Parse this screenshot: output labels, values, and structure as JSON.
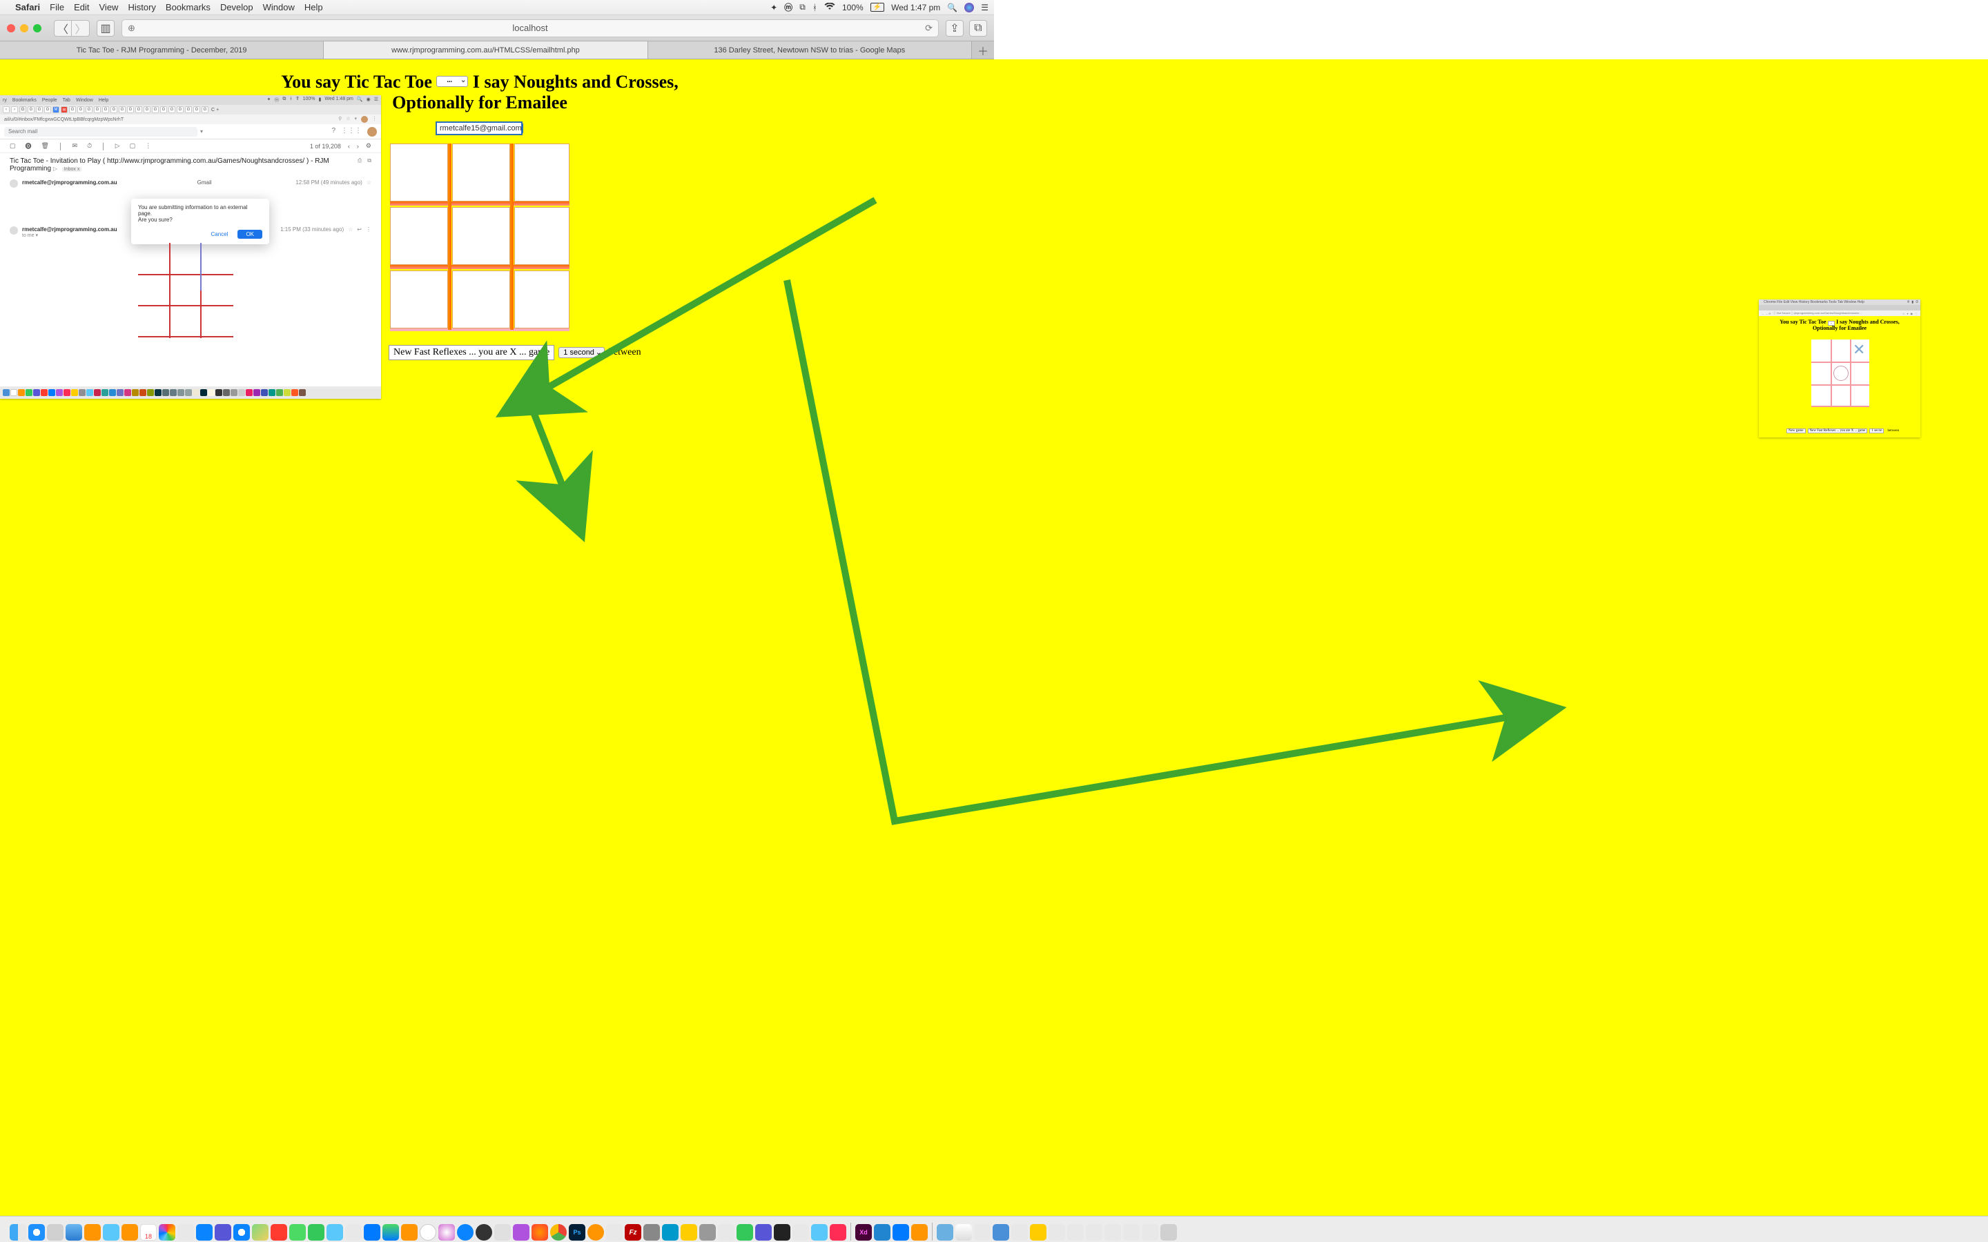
{
  "menubar": {
    "app": "Safari",
    "items": [
      "File",
      "Edit",
      "View",
      "History",
      "Bookmarks",
      "Develop",
      "Window",
      "Help"
    ],
    "battery": "100%",
    "clock": "Wed 1:47 pm"
  },
  "safari": {
    "url": "localhost",
    "tabs": [
      "Tic Tac Toe - RJM Programming - December, 2019",
      "www.rjmprogramming.com.au/HTMLCSS/emailhtml.php",
      "136 Darley Street, Newtown NSW to trias - Google Maps"
    ],
    "active_tab_index": 1
  },
  "page": {
    "headline_a": "You say Tic Tac Toe",
    "headline_select": "...",
    "headline_b": "I say Noughts and Crosses,",
    "headline_c": "Optionally for Emailee",
    "email_value": "rmetcalfe15@gmail.com",
    "status_text": "New Fast Reflexes ... you are X ... game",
    "status_select": "1 second",
    "status_after": "between"
  },
  "gmail": {
    "menubar_items": [
      "ry",
      "Bookmarks",
      "People",
      "Tab",
      "Window",
      "Help"
    ],
    "menubar_clock": "Wed 1:48 pm",
    "menubar_battery": "100%",
    "url": "ail/u/0/#inbox/FMfcgxwGCQWtLtpBBfcqrgMzpWpsNrhT",
    "search_placeholder": "Search mail",
    "count": "1 of 19,208",
    "subject": "Tic Tac Toe - Invitation to Play ( http://www.rjmprogramming.com.au/Games/Noughtsandcrosses/ ) - RJM Programming",
    "inbox_badge": "Inbox x",
    "from1": "rmetcalfe@rjmprogramming.com.au",
    "from1_label": "Gmail",
    "from1_time": "12:58 PM (49 minutes ago)",
    "dialog_line1": "You are submitting information to an external page.",
    "dialog_line2": "Are you sure?",
    "dialog_cancel": "Cancel",
    "dialog_ok": "OK",
    "from2": "rmetcalfe@rjmprogramming.com.au",
    "from2_to": "to me",
    "from2_time": "1:15 PM (33 minutes ago)"
  },
  "chrome_mini": {
    "menubar": "Chrome  File  Edit  View  History  Bookmarks  Tools  Tab  Window  Help",
    "url_prefix": "Not Secure",
    "url": "rjmprogramming.com.au/Games/Noughtsandcrosses/...",
    "headline_a": "You say Tic Tac Toe",
    "headline_b": "I say Noughts and Crosses,",
    "headline_c": "Optionally for Emailee",
    "btn_newgame": "New game",
    "status": "New Fast Reflexes ... you are X ... game",
    "sel": "1 secon",
    "after": "between"
  }
}
